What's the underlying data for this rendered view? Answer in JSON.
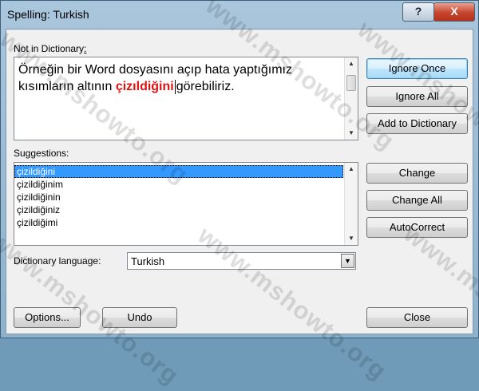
{
  "window": {
    "title": "Spelling: Turkish",
    "help_glyph": "?",
    "close_glyph": "X"
  },
  "not_in_dictionary": {
    "label": "Not in Dictionary",
    "label_suffix": ":",
    "text_before": "Örneğin bir Word dosyasını açıp hata yaptığımız kısımların altının ",
    "error_word": "çizıldiğini",
    "text_after": "görebiliriz."
  },
  "suggestions": {
    "label": "Suggestions:",
    "items": [
      "çizildiğini",
      "çizildiğinim",
      "çizildiğinin",
      "çizildiğiniz",
      "çizildiğimi"
    ]
  },
  "dictionary_language": {
    "label": "Dictionary language:",
    "value": "Turkish"
  },
  "buttons": {
    "ignore_once": "Ignore Once",
    "ignore_all": "Ignore All",
    "add_to_dictionary": "Add to Dictionary",
    "change": "Change",
    "change_all": "Change All",
    "autocorrect": "AutoCorrect",
    "options": "Options...",
    "undo": "Undo",
    "close": "Close"
  },
  "watermark": "www.mshowto.org",
  "scroll_glyphs": {
    "up": "▲",
    "down": "▼"
  }
}
